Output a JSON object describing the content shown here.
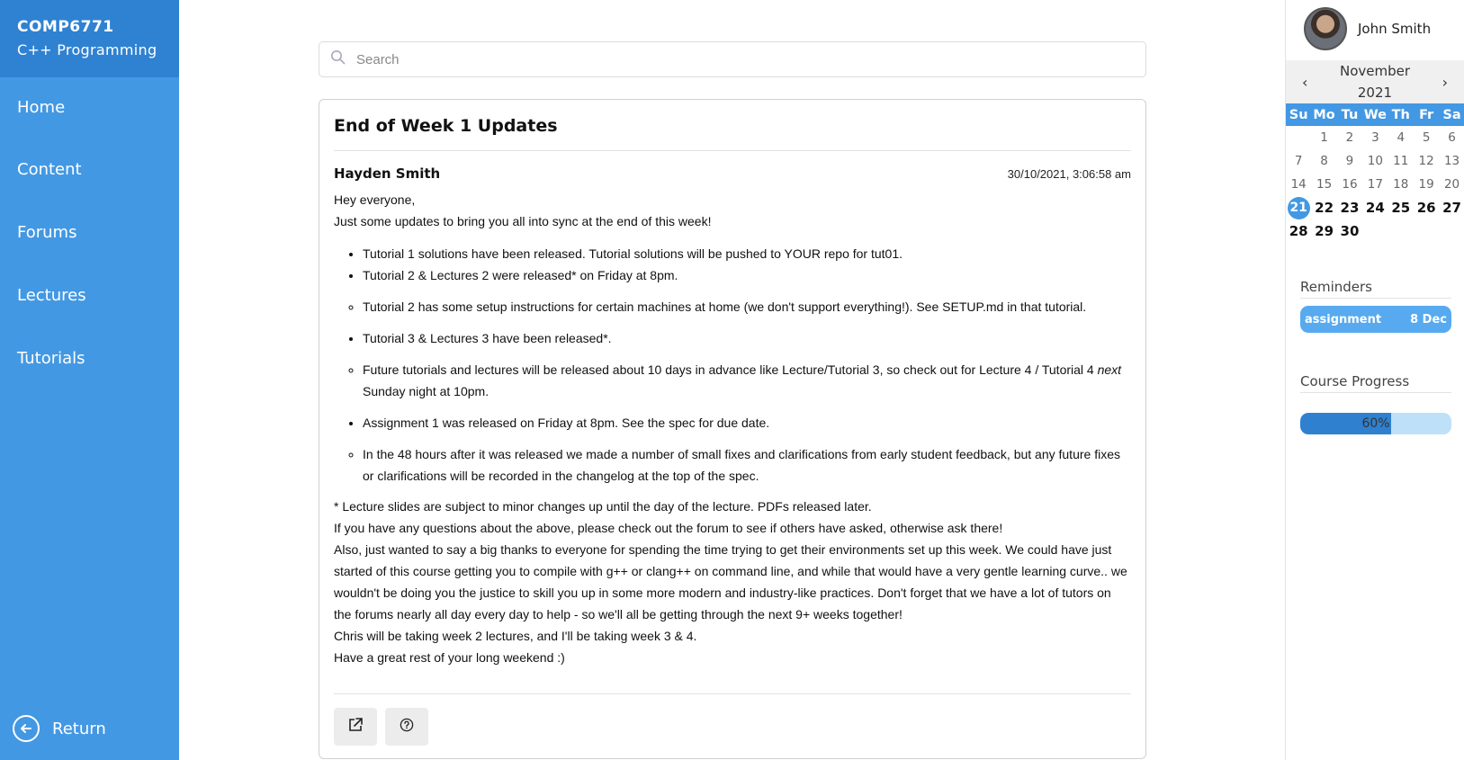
{
  "sidebar": {
    "course_code": "COMP6771",
    "course_name": "C++ Programming",
    "nav": [
      "Home",
      "Content",
      "Forums",
      "Lectures",
      "Tutorials"
    ],
    "return_label": "Return"
  },
  "search": {
    "placeholder": "Search"
  },
  "post": {
    "title": "End of Week 1 Updates",
    "author": "Hayden Smith",
    "date": "30/10/2021, 3:06:58 am",
    "intro": [
      "Hey everyone,",
      "Just some updates to bring you all into sync at the end of this week!"
    ],
    "bullets": [
      "Tutorial 1 solutions have been released. Tutorial solutions will be pushed to YOUR repo for tut01.",
      "Tutorial 2 & Lectures 2 were released* on Friday at 8pm.",
      "Tutorial 2 has some setup instructions for certain machines at home (we don't support everything!). See SETUP.md in that tutorial.",
      "Tutorial 3 & Lectures 3 have been released*.",
      "Future tutorials and lectures will be released about 10 days in advance like Lecture/Tutorial 3, so check out for Lecture 4 / Tutorial 4 ",
      "next",
      " Sunday night at 10pm.",
      "Assignment 1 was released on Friday at 8pm. See the spec for due date.",
      "In the 48 hours after it was released we made a number of small fixes and clarifications from early student feedback, but any future fixes or clarifications will be recorded in the changelog at the top of the spec."
    ],
    "outro": [
      "* Lecture slides are subject to minor changes up until the day of the lecture. PDFs released later.",
      "If you have any questions about the above, please check out the forum to see if others have asked, otherwise ask there!",
      "Also, just wanted to say a big thanks to everyone for spending the time trying to get their environments set up this week. We could have just started of this course getting you to compile with g++ or clang++ on command line, and while that would have a very gentle learning curve.. we wouldn't be doing you the justice to skill you up in some more modern and industry-like practices. Don't forget that we have a lot of tutors on the forums nearly all day every day to help - so we'll all be getting through the next 9+ weeks together!",
      "Chris will be taking week 2 lectures, and I'll be taking week 3 & 4.",
      "Have a great rest of your long weekend :)"
    ],
    "actions": [
      "external-link-icon",
      "help-icon"
    ]
  },
  "user": {
    "name": "John Smith"
  },
  "calendar": {
    "month": "November",
    "year": "2021",
    "weekdays": [
      "Su",
      "Mo",
      "Tu",
      "We",
      "Th",
      "Fr",
      "Sa"
    ],
    "leading_blanks": 1,
    "days_in_month": 30,
    "today": 21
  },
  "reminders": {
    "title": "Reminders",
    "items": [
      {
        "label": "assignment",
        "date": "8 Dec"
      }
    ]
  },
  "progress": {
    "title": "Course Progress",
    "value": 0.6,
    "label": "60%"
  },
  "colors": {
    "sidebar": "#4398e3",
    "brand": "#2f82d1",
    "progress_fill": "#2f80cf",
    "progress_track": "#bfe0f9"
  }
}
